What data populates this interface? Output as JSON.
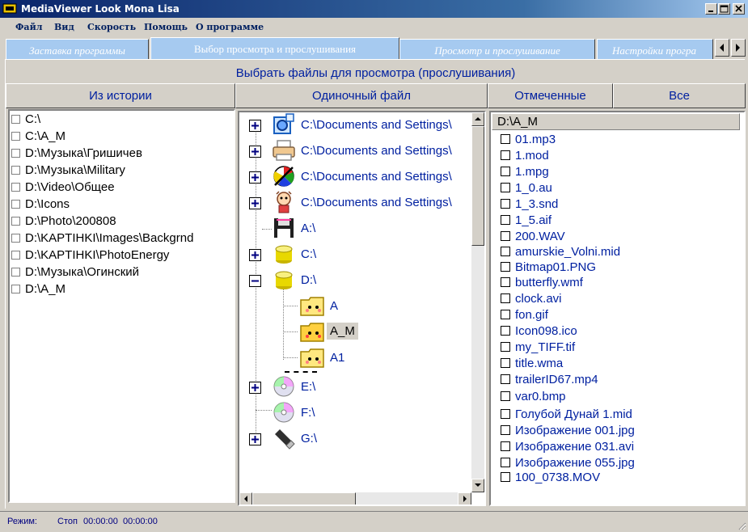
{
  "window": {
    "title": "MediaViewer Look Mona Lisa",
    "controls": [
      "minimize",
      "maximize",
      "close"
    ]
  },
  "menu": {
    "items": [
      "Файл",
      "Вид",
      "Скорость",
      "Помощь",
      "О программе"
    ]
  },
  "tabs": {
    "items": [
      {
        "label": "Заставка программы",
        "active": false
      },
      {
        "label": "Выбор просмотра и прослушивания",
        "active": true
      },
      {
        "label": "Просмотр и прослушивание",
        "active": false
      },
      {
        "label": "Настройки програ",
        "active": false
      }
    ]
  },
  "main": {
    "title": "Выбрать файлы для просмотра (прослушивания)",
    "buttons": {
      "history": "Из истории",
      "single": "Одиночный файл",
      "marked": "Отмеченные",
      "all": "Все"
    }
  },
  "history": {
    "items": [
      "C:\\",
      "C:\\A_M",
      "D:\\Музыка\\Гришичев",
      "D:\\Музыка\\Military",
      "D:\\Video\\Общее",
      "D:\\Icons",
      "D:\\Photo\\200808",
      "D:\\KAPTIHKI\\Images\\Backgrnd",
      "D:\\KAPTIHKI\\PhotoEnergy",
      "D:\\Музыка\\Огинский",
      "D:\\A_M"
    ]
  },
  "tree": {
    "nodes": [
      {
        "label": "C:\\Documents and Settings\\",
        "icon": "folder-settings-icon",
        "expander": "plus"
      },
      {
        "label": "C:\\Documents and Settings\\",
        "icon": "printer-icon",
        "expander": "plus"
      },
      {
        "label": "C:\\Documents and Settings\\",
        "icon": "palette-icon",
        "expander": "plus"
      },
      {
        "label": "C:\\Documents and Settings\\",
        "icon": "cartoon-icon",
        "expander": "plus"
      },
      {
        "label": "A:\\",
        "icon": "floppy-icon",
        "expander": "none"
      },
      {
        "label": "C:\\",
        "icon": "disk-icon",
        "expander": "plus"
      },
      {
        "label": "D:\\",
        "icon": "disk-icon",
        "expander": "minus"
      },
      {
        "label": "A",
        "icon": "folder-face-icon",
        "expander": "none"
      },
      {
        "label": "A_M",
        "icon": "folder-face-icon",
        "expander": "none",
        "selected": true
      },
      {
        "label": "A1",
        "icon": "folder-face-icon",
        "expander": "none"
      },
      {
        "label": "E:\\",
        "icon": "cd-icon",
        "expander": "plus"
      },
      {
        "label": "F:\\",
        "icon": "cd-icon",
        "expander": "none"
      },
      {
        "label": "G:\\",
        "icon": "usb-icon",
        "expander": "plus"
      }
    ]
  },
  "filelist": {
    "header": "D:\\A_M",
    "items": [
      "01.mp3",
      "1.mod",
      "1.mpg",
      "1_0.au",
      "1_3.snd",
      "1_5.aif",
      "200.WAV",
      "amurskie_Volni.mid",
      "Bitmap01.PNG",
      "butterfly.wmf",
      "clock.avi",
      "fon.gif",
      "Icon098.ico",
      "my_TIFF.tif",
      "title.wma",
      "trailerID67.mp4",
      "var0.bmp",
      "Голубой Дунай 1.mid",
      "Изображение 001.jpg",
      "Изображение 031.avi",
      "Изображение 055.jpg",
      "100_0738.MOV"
    ]
  },
  "status": {
    "mode_label": "Режим:",
    "state": "Стоп",
    "time1": "00:00:00",
    "time2": "00:00:00"
  },
  "colors": {
    "accent_text": "#0020a0",
    "tab_bg": "#a6caf0",
    "face": "#d4d0c8"
  }
}
